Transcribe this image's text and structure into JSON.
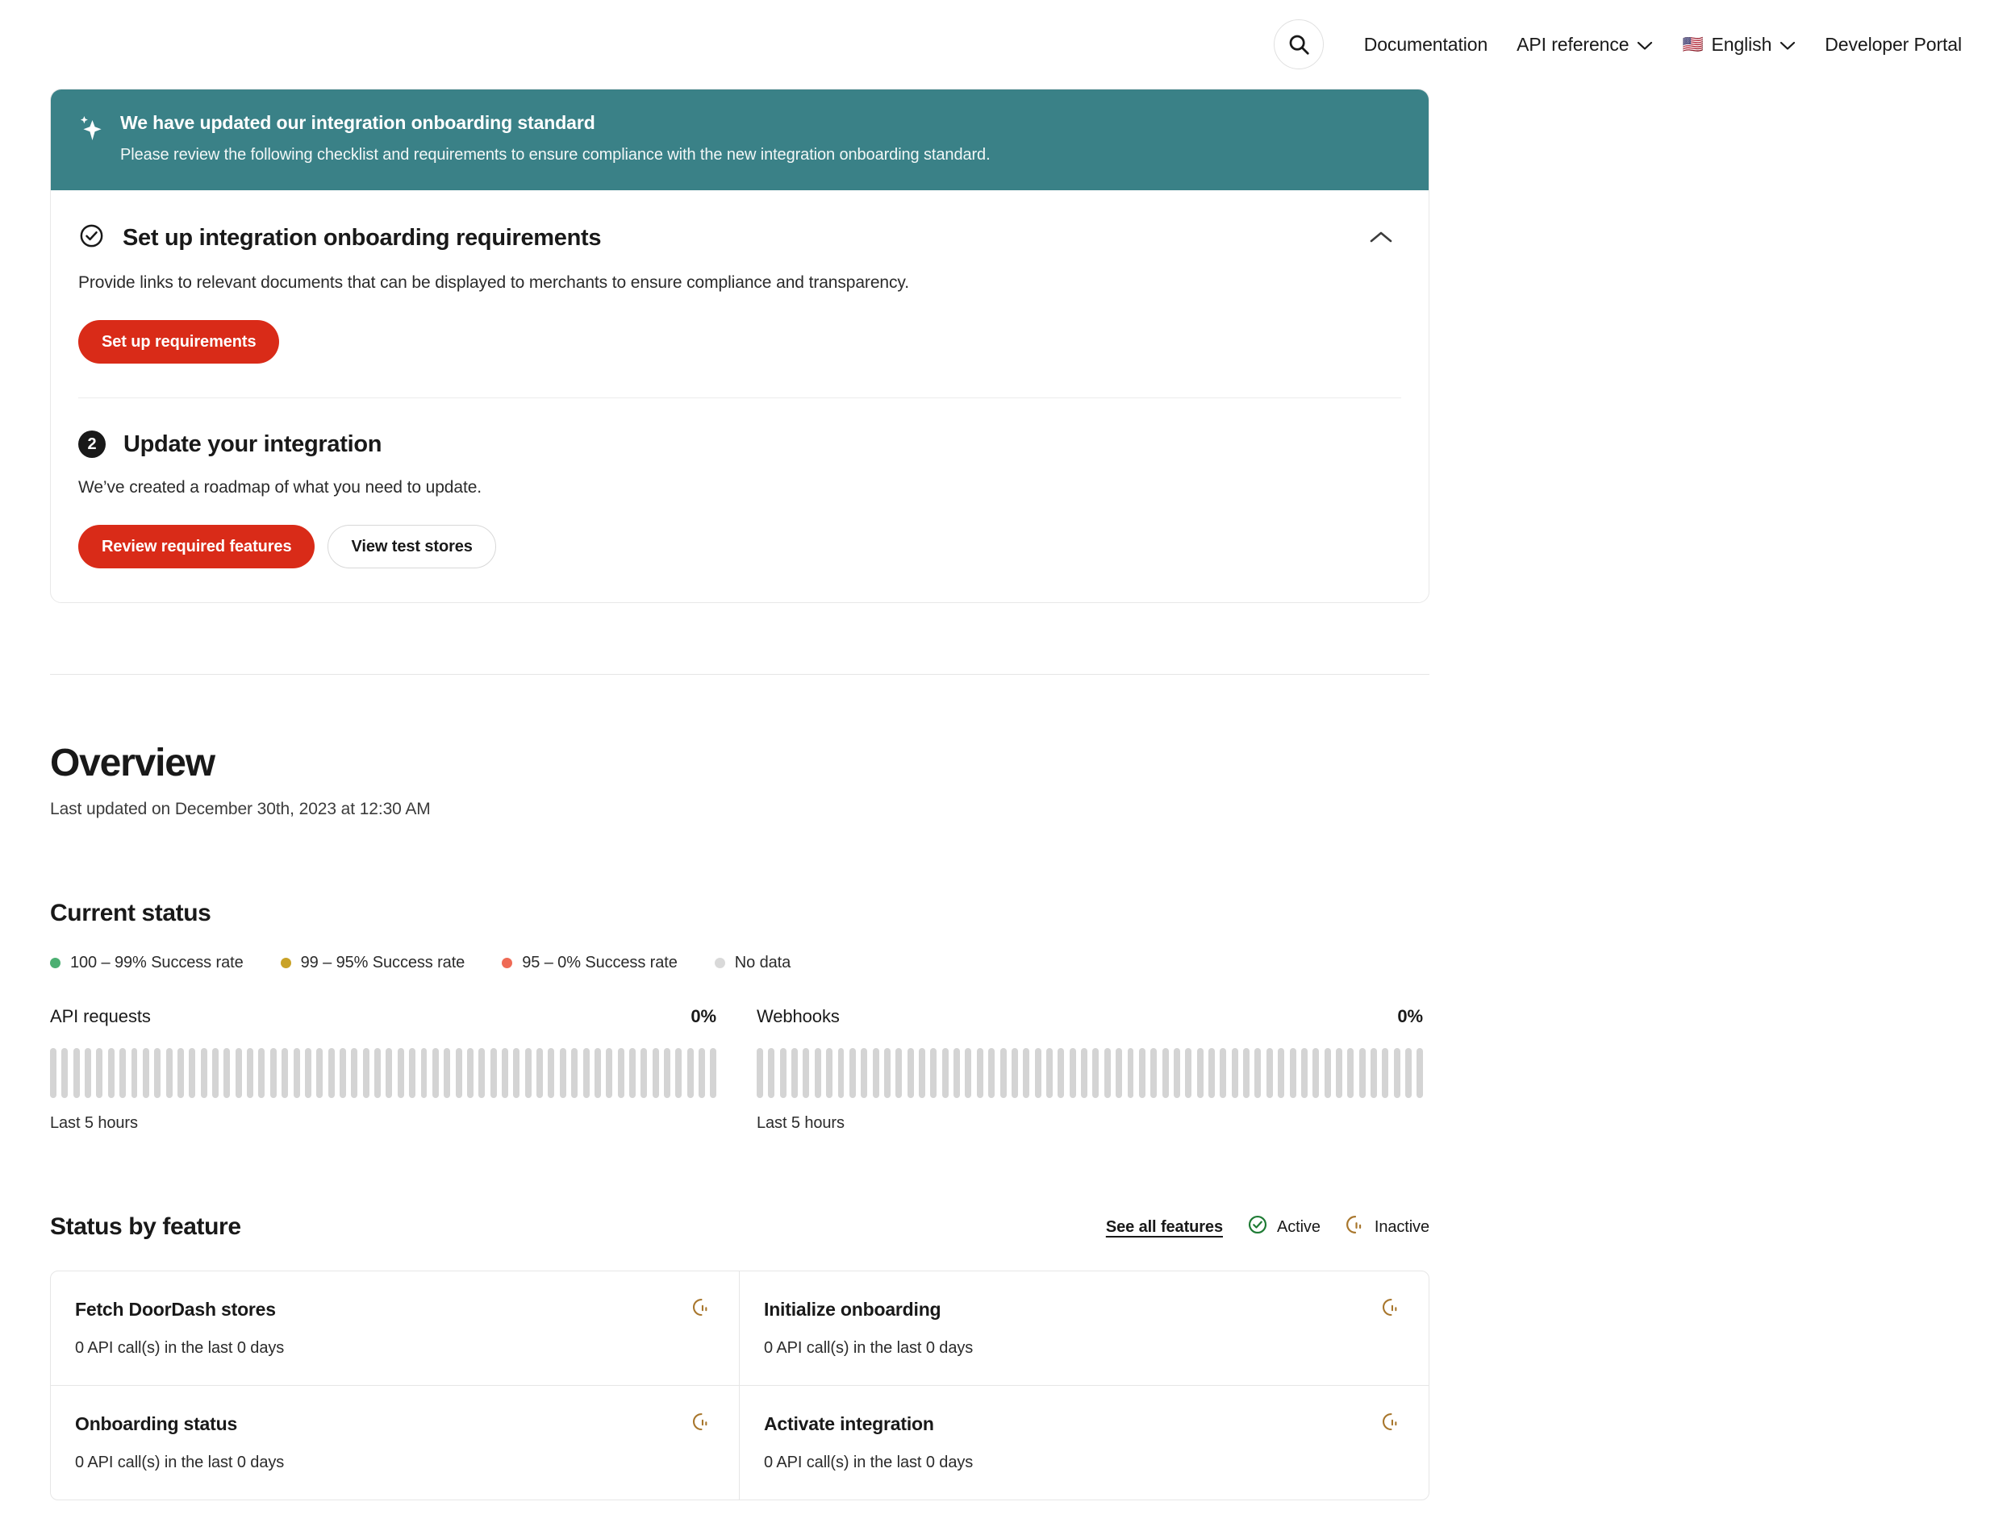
{
  "nav": {
    "search_icon": "search-icon",
    "links": [
      {
        "label": "Documentation",
        "has_caret": false
      },
      {
        "label": "API reference",
        "has_caret": true
      },
      {
        "label": "English",
        "has_caret": true,
        "flag": "🇺🇸"
      },
      {
        "label": "Developer Portal",
        "has_caret": false
      }
    ]
  },
  "banner": {
    "icon": "sparkle-icon",
    "title": "We have updated our integration onboarding standard",
    "subtitle": "Please review the following checklist and requirements to ensure compliance with the new integration onboarding standard.",
    "color": "#3a8187"
  },
  "steps": [
    {
      "icon": "check-circle-icon",
      "title": "Set up integration onboarding requirements",
      "description": "Provide links to relevant documents that can be displayed to merchants to ensure compliance and transparency.",
      "collapse_icon": "chevron-up-icon",
      "buttons": [
        {
          "label": "Set up requirements",
          "style": "primary"
        }
      ]
    },
    {
      "badge": "2",
      "title": "Update your integration",
      "description": "We’ve created a roadmap of what you need to update.",
      "buttons": [
        {
          "label": "Review required features",
          "style": "primary"
        },
        {
          "label": "View test stores",
          "style": "secondary"
        }
      ]
    }
  ],
  "overview": {
    "title": "Overview",
    "last_updated": "Last updated on December 30th, 2023 at 12:30 AM"
  },
  "current_status": {
    "title": "Current status",
    "legend": [
      {
        "label": "100 – 99% Success rate",
        "color": "#4caf72"
      },
      {
        "label": "99 – 95% Success rate",
        "color": "#c9a227"
      },
      {
        "label": "95 – 0% Success rate",
        "color": "#ef6a55"
      },
      {
        "label": "No data",
        "color": "#d4d4d4"
      }
    ]
  },
  "chart_data": [
    {
      "type": "bar",
      "title": "API requests",
      "value_label": "0%",
      "xlabel": "Last 5 hours",
      "ylabel": "",
      "categories": [],
      "values": [
        0,
        0,
        0,
        0,
        0,
        0,
        0,
        0,
        0,
        0,
        0,
        0,
        0,
        0,
        0,
        0,
        0,
        0,
        0,
        0,
        0,
        0,
        0,
        0,
        0,
        0,
        0,
        0,
        0,
        0,
        0,
        0,
        0,
        0,
        0,
        0,
        0,
        0,
        0,
        0,
        0,
        0,
        0,
        0,
        0,
        0,
        0,
        0,
        0,
        0,
        0,
        0,
        0,
        0,
        0,
        0,
        0,
        0
      ],
      "bar_count": 58,
      "bar_color": "#d4d4d4",
      "note": "all bars show 'No data' grey"
    },
    {
      "type": "bar",
      "title": "Webhooks",
      "value_label": "0%",
      "xlabel": "Last 5 hours",
      "ylabel": "",
      "categories": [],
      "values": [
        0,
        0,
        0,
        0,
        0,
        0,
        0,
        0,
        0,
        0,
        0,
        0,
        0,
        0,
        0,
        0,
        0,
        0,
        0,
        0,
        0,
        0,
        0,
        0,
        0,
        0,
        0,
        0,
        0,
        0,
        0,
        0,
        0,
        0,
        0,
        0,
        0,
        0,
        0,
        0,
        0,
        0,
        0,
        0,
        0,
        0,
        0,
        0,
        0,
        0,
        0,
        0,
        0,
        0,
        0,
        0,
        0,
        0
      ],
      "bar_count": 58,
      "bar_color": "#d4d4d4",
      "note": "all bars show 'No data' grey"
    }
  ],
  "features": {
    "title": "Status by feature",
    "see_all_label": "See all features",
    "keys": [
      {
        "label": "Active",
        "icon": "check-circle-icon",
        "color": "#1e7b34"
      },
      {
        "label": "Inactive",
        "icon": "inactive-gauge-icon",
        "color": "#a8762c"
      }
    ],
    "items": [
      {
        "name": "Fetch DoorDash stores",
        "detail": "0 API call(s) in the last 0 days",
        "status": "Inactive"
      },
      {
        "name": "Initialize onboarding",
        "detail": "0 API call(s) in the last 0 days",
        "status": "Inactive"
      },
      {
        "name": "Onboarding status",
        "detail": "0 API call(s) in the last 0 days",
        "status": "Inactive"
      },
      {
        "name": "Activate integration",
        "detail": "0 API call(s) in the last 0 days",
        "status": "Inactive"
      }
    ]
  }
}
